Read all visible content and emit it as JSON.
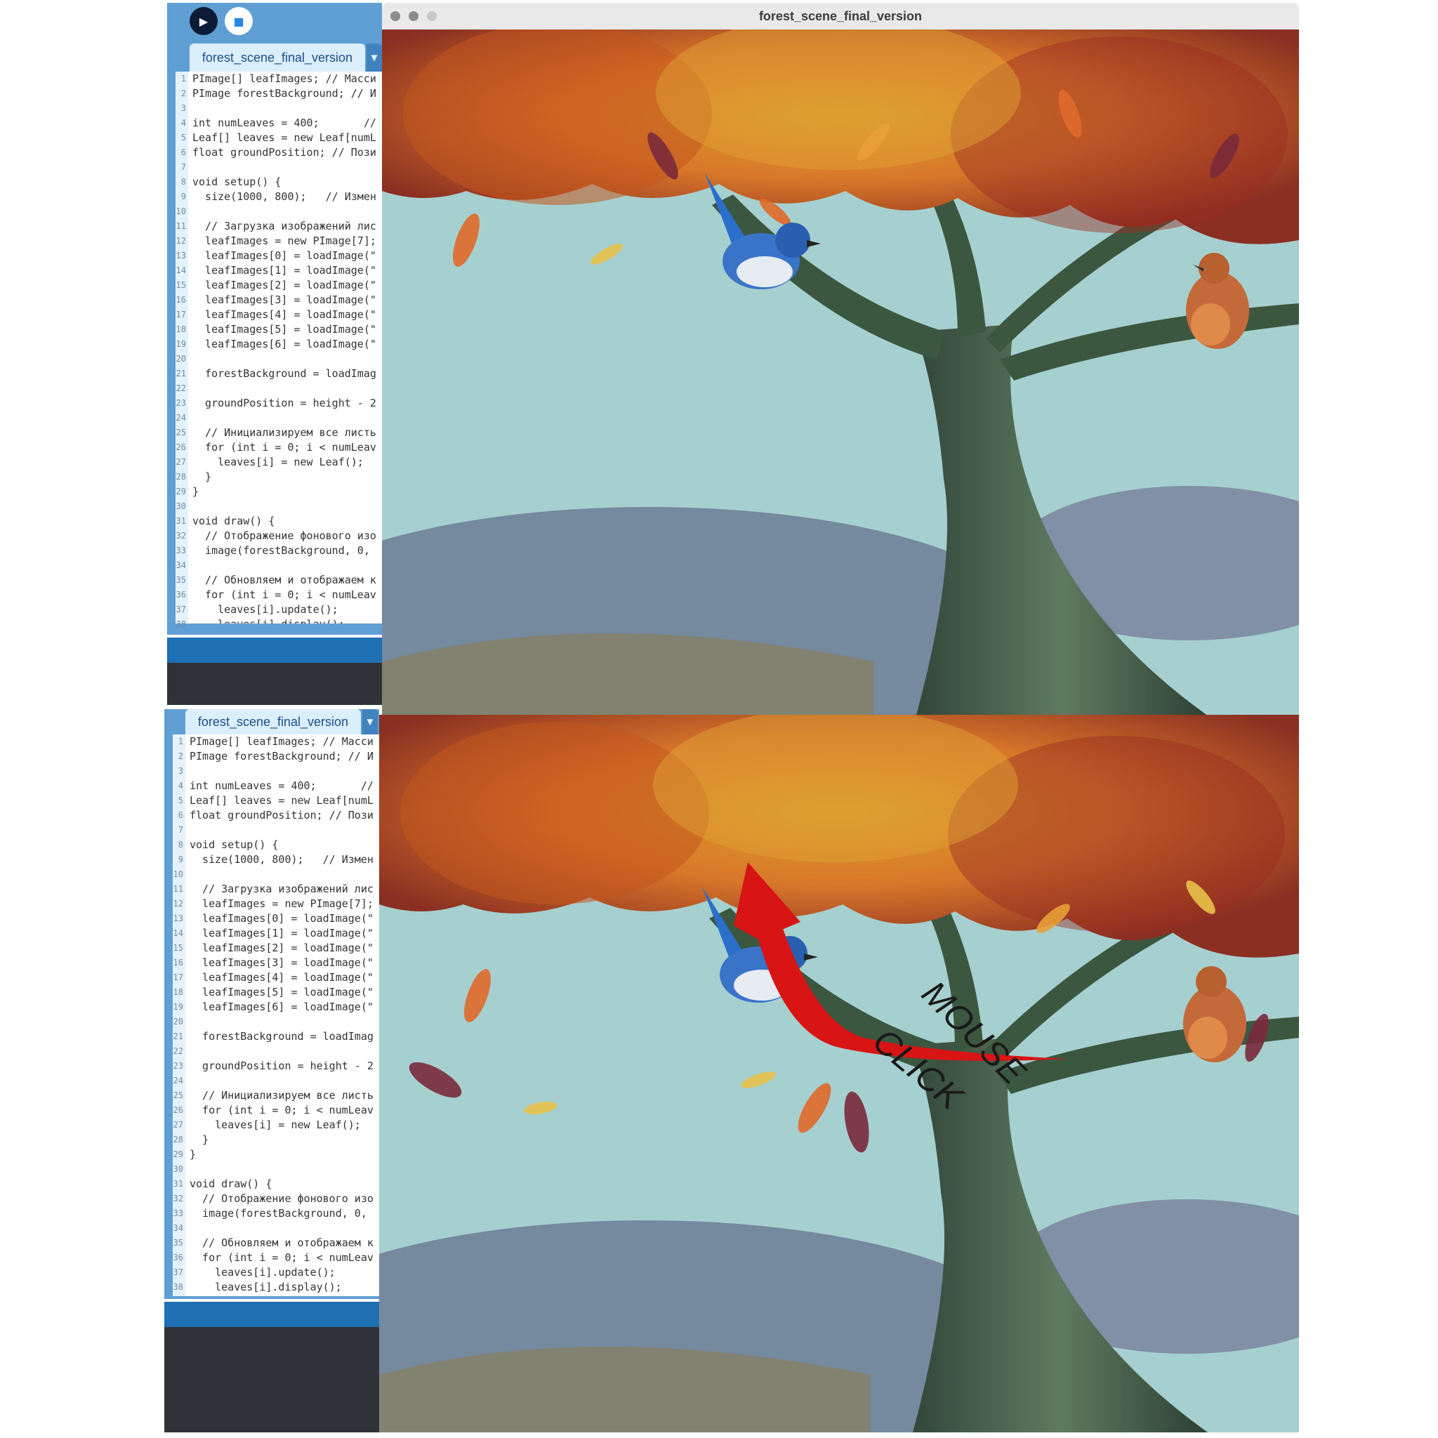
{
  "top": {
    "tab_label": "forest_scene_final_version",
    "window_title": "forest_scene_final_version"
  },
  "bottom": {
    "tab_label": "forest_scene_final_version"
  },
  "code_lines": [
    {
      "n": "1",
      "t": "PImage[] leafImages; // Масси"
    },
    {
      "n": "2",
      "t": "PImage forestBackground; // И"
    },
    {
      "n": "3",
      "t": ""
    },
    {
      "n": "4",
      "t": "int numLeaves = 400;       //"
    },
    {
      "n": "5",
      "t": "Leaf[] leaves = new Leaf[numL"
    },
    {
      "n": "6",
      "t": "float groundPosition; // Пози"
    },
    {
      "n": "7",
      "t": ""
    },
    {
      "n": "8",
      "t": "void setup() {"
    },
    {
      "n": "9",
      "t": "  size(1000, 800);   // Измен"
    },
    {
      "n": "10",
      "t": ""
    },
    {
      "n": "11",
      "t": "  // Загрузка изображений лис"
    },
    {
      "n": "12",
      "t": "  leafImages = new PImage[7];"
    },
    {
      "n": "13",
      "t": "  leafImages[0] = loadImage(\""
    },
    {
      "n": "14",
      "t": "  leafImages[1] = loadImage(\""
    },
    {
      "n": "15",
      "t": "  leafImages[2] = loadImage(\""
    },
    {
      "n": "16",
      "t": "  leafImages[3] = loadImage(\""
    },
    {
      "n": "17",
      "t": "  leafImages[4] = loadImage(\""
    },
    {
      "n": "18",
      "t": "  leafImages[5] = loadImage(\""
    },
    {
      "n": "19",
      "t": "  leafImages[6] = loadImage(\""
    },
    {
      "n": "20",
      "t": ""
    },
    {
      "n": "21",
      "t": "  forestBackground = loadImag"
    },
    {
      "n": "22",
      "t": ""
    },
    {
      "n": "23",
      "t": "  groundPosition = height - 2"
    },
    {
      "n": "24",
      "t": ""
    },
    {
      "n": "25",
      "t": "  // Инициализируем все листь"
    },
    {
      "n": "26",
      "t": "  for (int i = 0; i < numLeav"
    },
    {
      "n": "27",
      "t": "    leaves[i] = new Leaf();"
    },
    {
      "n": "28",
      "t": "  }"
    },
    {
      "n": "29",
      "t": "}"
    },
    {
      "n": "30",
      "t": ""
    },
    {
      "n": "31",
      "t": "void draw() {"
    },
    {
      "n": "32",
      "t": "  // Отображение фонового изо"
    },
    {
      "n": "33",
      "t": "  image(forestBackground, 0, "
    },
    {
      "n": "34",
      "t": ""
    },
    {
      "n": "35",
      "t": "  // Обновляем и отображаем к"
    },
    {
      "n": "36",
      "t": "  for (int i = 0; i < numLeav"
    },
    {
      "n": "37",
      "t": "    leaves[i].update();"
    },
    {
      "n": "38",
      "t": "    leaves[i].display();"
    }
  ],
  "annotation": {
    "text_line1": "MOUSE",
    "text_line2": "CLICK",
    "arrow_color": "#d81414"
  },
  "colors": {
    "ide_blue": "#5f9fd3",
    "sky": "#a6d0cf",
    "trunk": "#46604a",
    "foliage_orange": "#d9772a",
    "foliage_red": "#a8342a"
  }
}
